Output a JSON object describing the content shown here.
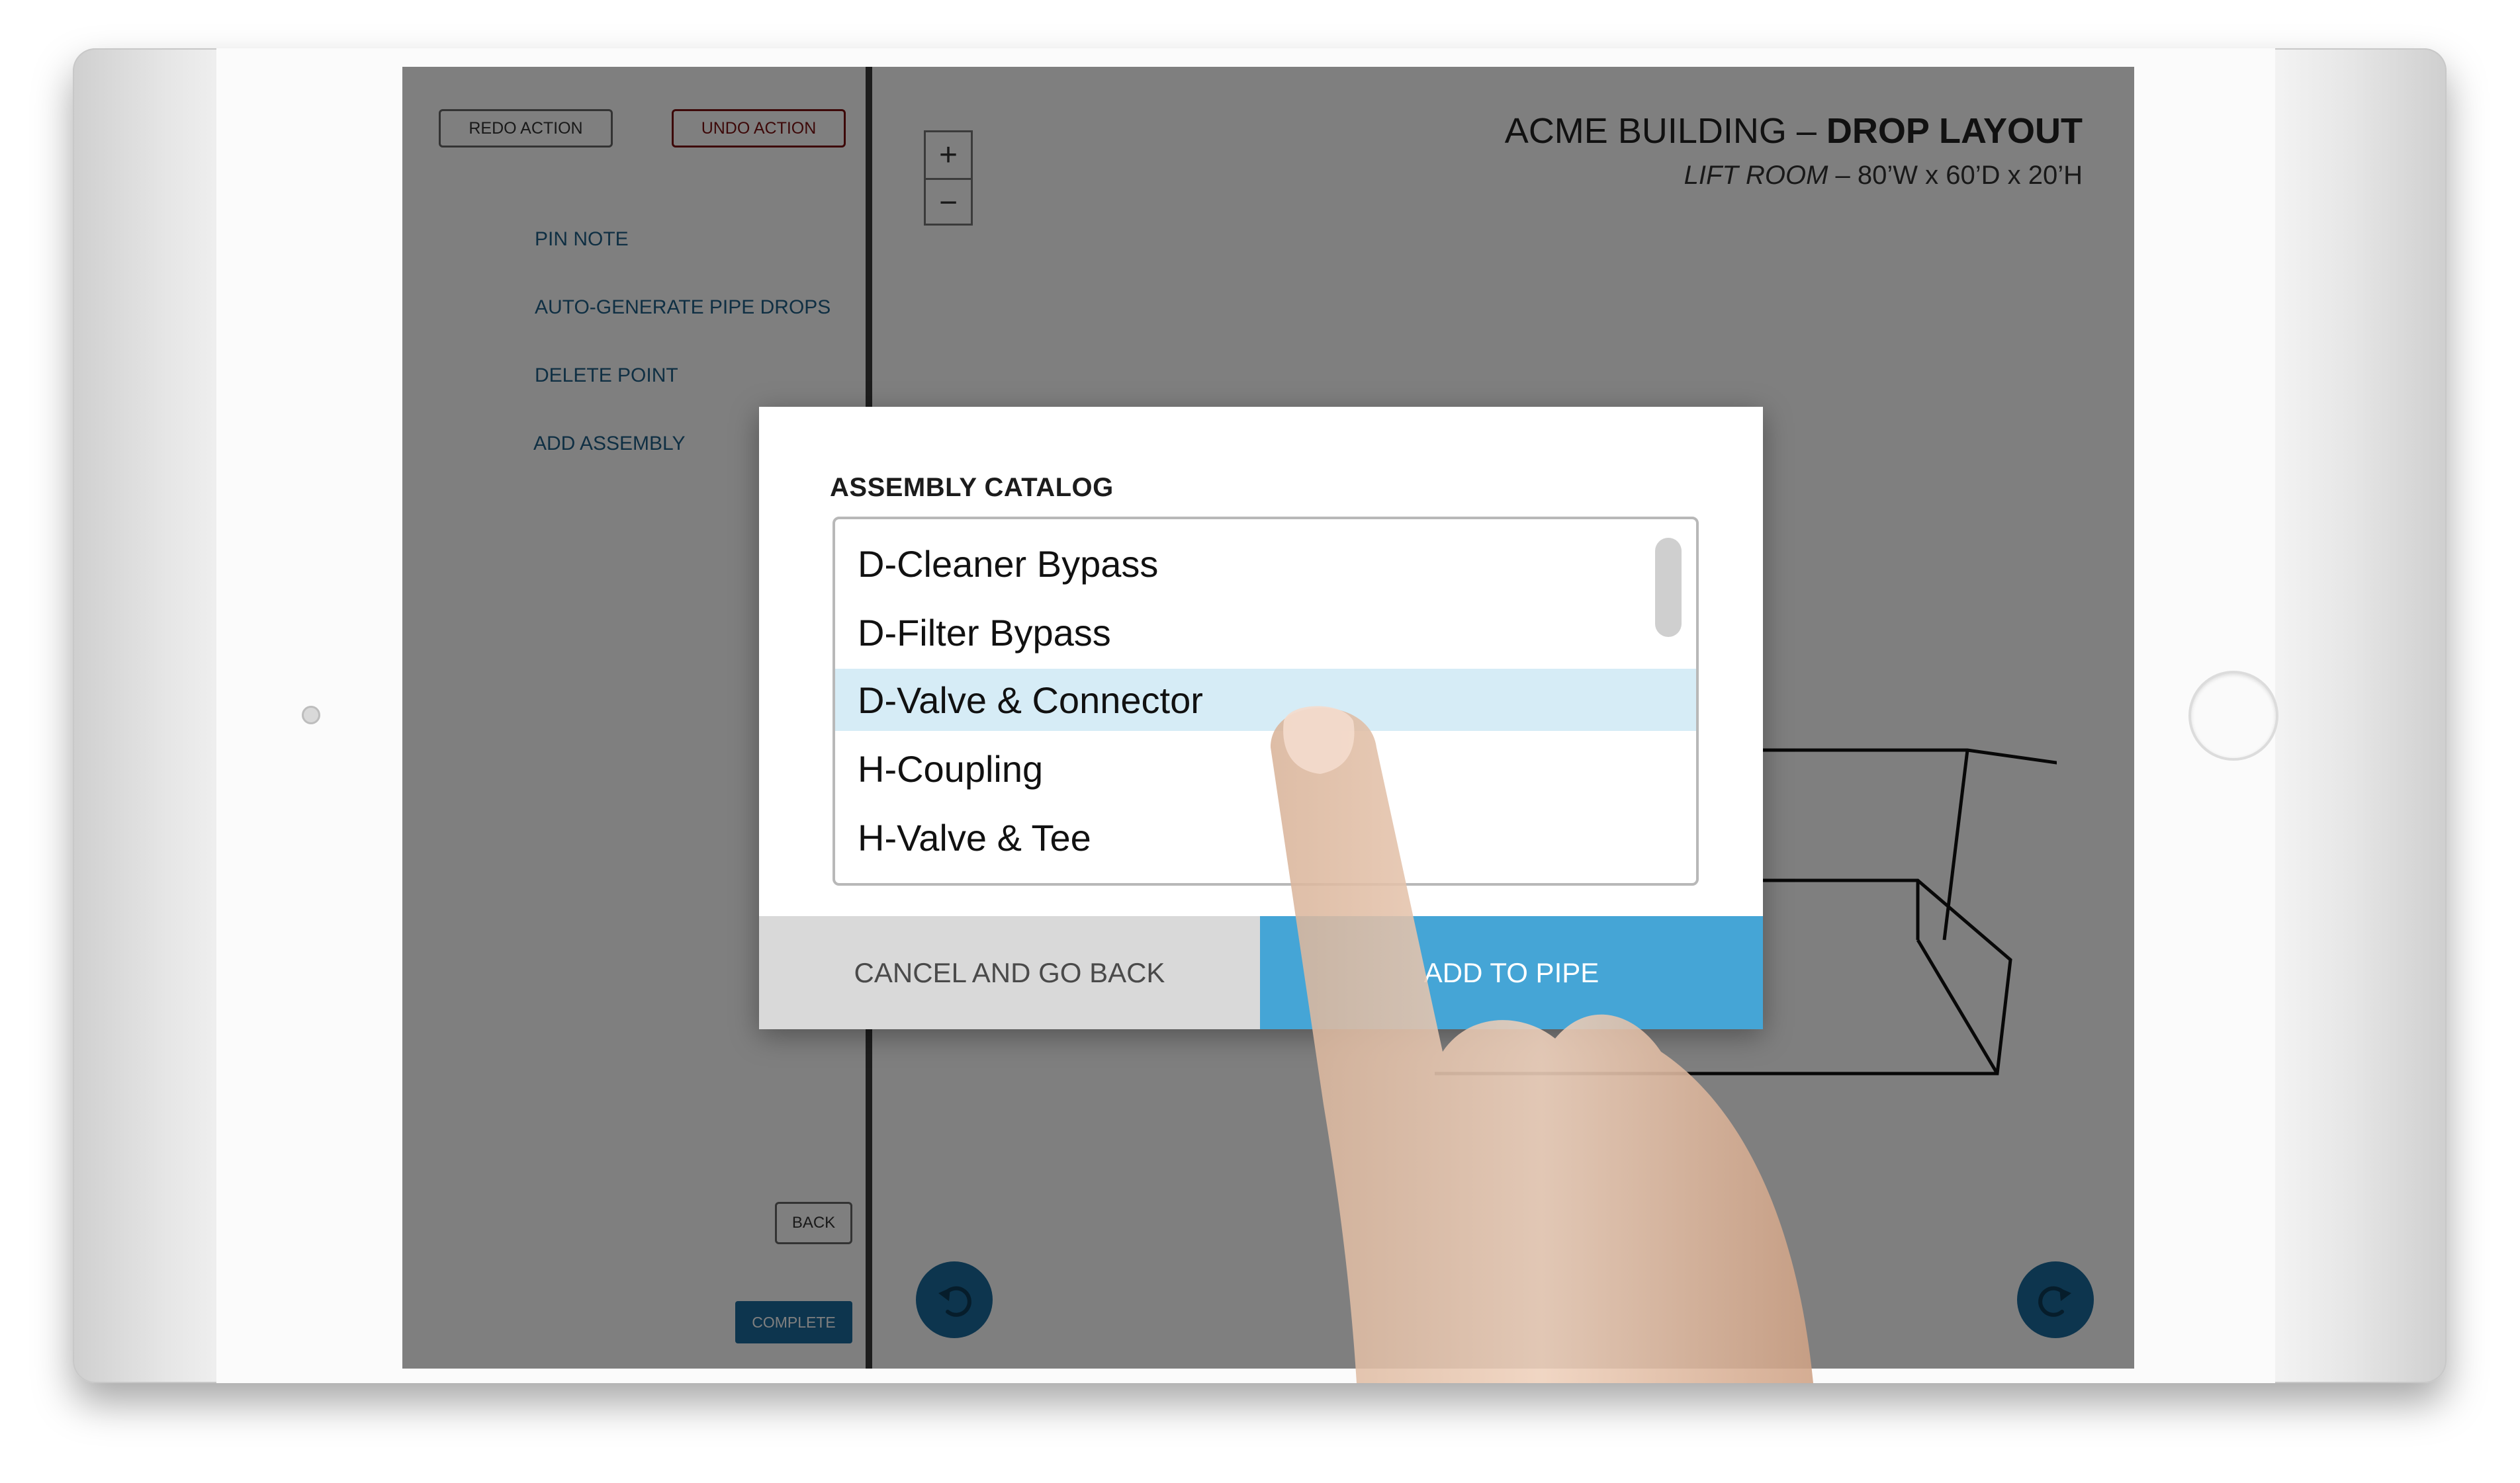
{
  "sidebar": {
    "redo_label": "REDO ACTION",
    "undo_label": "UNDO ACTION",
    "links": [
      "PIN NOTE",
      "AUTO-GENERATE PIPE DROPS",
      "DELETE POINT",
      "ADD ASSEMBLY"
    ],
    "back_label": "BACK",
    "complete_label": "COMPLETE"
  },
  "zoom": {
    "in": "+",
    "out": "−"
  },
  "header": {
    "building": "ACME BUILDING",
    "separator": " – ",
    "layout": "DROP LAYOUT",
    "room": "LIFT ROOM",
    "room_sep": " – ",
    "dimensions": "80’W x 60’D x 20’H"
  },
  "modal": {
    "title": "ASSEMBLY CATALOG",
    "items": [
      "D-Cleaner Bypass",
      "D-Filter Bypass",
      "D-Valve & Connector",
      "H-Coupling",
      "H-Valve & Tee"
    ],
    "selected_item": "D-Valve & Connector",
    "cancel_label": "CANCEL AND GO BACK",
    "add_label": "ADD TO PIPE"
  },
  "colors": {
    "accent": "#1a6a9c",
    "add_button": "#45a5d6",
    "selected_row": "#d6ecf6",
    "undo_text": "#7a1010"
  },
  "icons": [
    "undo-arrow-icon",
    "redo-arrow-icon",
    "camera-icon",
    "home-button-icon"
  ]
}
